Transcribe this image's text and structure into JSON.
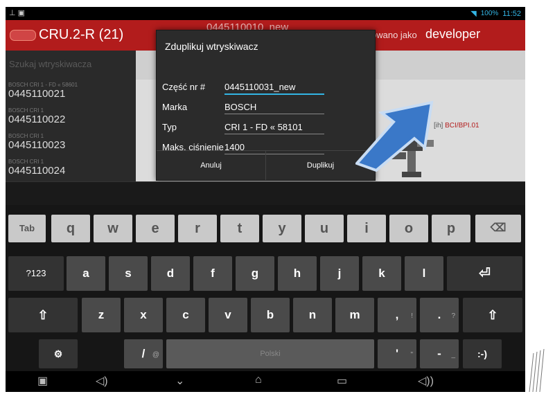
{
  "status": {
    "battery": "100%",
    "time": "11:52"
  },
  "appbar": {
    "title": "CRU.2-R (21)",
    "bg_title": "0445110010_new",
    "logged_as": "owano jako",
    "user": "developer"
  },
  "sidebar": {
    "search_placeholder": "Szukaj wtryskiwacza",
    "items": [
      {
        "sub": "BOSCH   CRI 1 - FD « 58601",
        "num": "0445110021"
      },
      {
        "sub": "BOSCH   CRI 1",
        "num": "0445110022"
      },
      {
        "sub": "BOSCH   CRI 1",
        "num": "0445110023"
      },
      {
        "sub": "BOSCH   CRI 1",
        "num": "0445110024"
      }
    ]
  },
  "main": {
    "ih_prefix": "[ih]",
    "ih_value": "BCI/BPI.01"
  },
  "dialog": {
    "title": "Zduplikuj wtryskiwacz",
    "fields": [
      {
        "label": "Część nr #",
        "value": "0445110031_new"
      },
      {
        "label": "Marka",
        "value": "BOSCH"
      },
      {
        "label": "Typ",
        "value": "CRI 1 - FD « 58101"
      },
      {
        "label": "Maks. ciśnienie",
        "value": "1400"
      }
    ],
    "cancel": "Anuluj",
    "confirm": "Duplikuj"
  },
  "keyboard": {
    "row1": [
      "Tab",
      "q",
      "w",
      "e",
      "r",
      "t",
      "y",
      "u",
      "i",
      "o",
      "p"
    ],
    "row2": [
      "?123",
      "a",
      "s",
      "d",
      "f",
      "g",
      "h",
      "j",
      "k",
      "l"
    ],
    "row3": [
      "z",
      "x",
      "c",
      "v",
      "b",
      "n",
      "m",
      ",",
      "."
    ],
    "row3_hints": [
      "!",
      "?"
    ],
    "row4": {
      "symbols": "⚙",
      "slash": "/",
      "slash_hint": "@",
      "space": "Polski",
      "apostrophe": "'",
      "apostrophe_hint": "\"",
      "dash": "-",
      "dash_hint": "_",
      "smiley": ":-)"
    }
  },
  "icons": {
    "backspace": "⌫",
    "enter": "⏎",
    "shift": "⇧"
  },
  "colors": {
    "accent": "#33b5e5",
    "brand": "#b21c1c",
    "arrow": "#3a78c8"
  }
}
